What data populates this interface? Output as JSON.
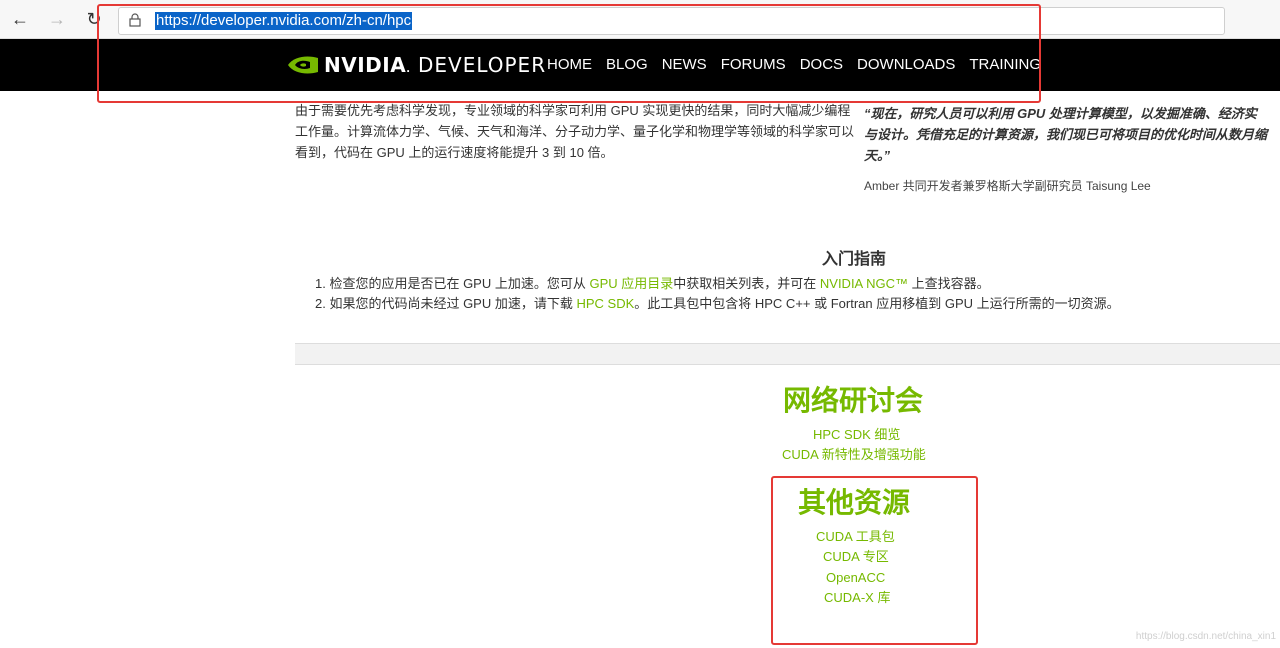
{
  "browser": {
    "back_icon": "arrow-left-icon",
    "forward_icon": "arrow-right-icon",
    "refresh_icon": "refresh-icon",
    "url": "https://developer.nvidia.com/zh-cn/hpc"
  },
  "header": {
    "logo_text": "NVIDIA",
    "logo_sub": "DEVELOPER",
    "nav": [
      "HOME",
      "BLOG",
      "NEWS",
      "FORUMS",
      "DOCS",
      "DOWNLOADS",
      "TRAINING"
    ]
  },
  "intro": {
    "paragraph": "由于需要优先考虑科学发现，专业领域的科学家可利用 GPU 实现更快的结果，同时大幅减少编程工作量。计算流体力学、气候、天气和海洋、分子动力学、量子化学和物理学等领域的科学家可以看到，代码在 GPU 上的运行速度将能提升 3 到 10 倍。",
    "quote": "“现在，研究人员可以利用 GPU 处理计算模型，以发掘准确、经济实\n与设计。凭借充足的计算资源，我们现已可将项目的优化时间从数月缩\n天。”",
    "attribution": "Amber 共同开发者兼罗格斯大学副研究员 Taisung Lee"
  },
  "getting_started": {
    "title": "入门指南",
    "step1_a": "1. 检查您的应用是否已在 GPU 上加速。您可从 ",
    "step1_link1": "GPU 应用目录",
    "step1_b": "中获取相关列表，并可在 ",
    "step1_link2": "NVIDIA NGC™",
    "step1_c": " 上查找容器。",
    "step2_a": "2. 如果您的代码尚未经过 GPU 加速，请下载 ",
    "step2_link": "HPC SDK",
    "step2_b": "。此工具包中包含将 HPC C++ 或 Fortran 应用移植到 GPU 上运行所需的一切资源。"
  },
  "webinars": {
    "title": "网络研讨会",
    "links": [
      "HPC SDK 细览",
      "CUDA 新特性及增强功能"
    ]
  },
  "other_resources": {
    "title": "其他资源",
    "links": [
      "CUDA 工具包",
      "CUDA 专区",
      "OpenACC",
      "CUDA-X 库"
    ]
  },
  "watermark": "https://blog.csdn.net/china_xin1",
  "colors": {
    "accent": "#76b900",
    "highlight": "#e53935",
    "header_bg": "#000000"
  }
}
